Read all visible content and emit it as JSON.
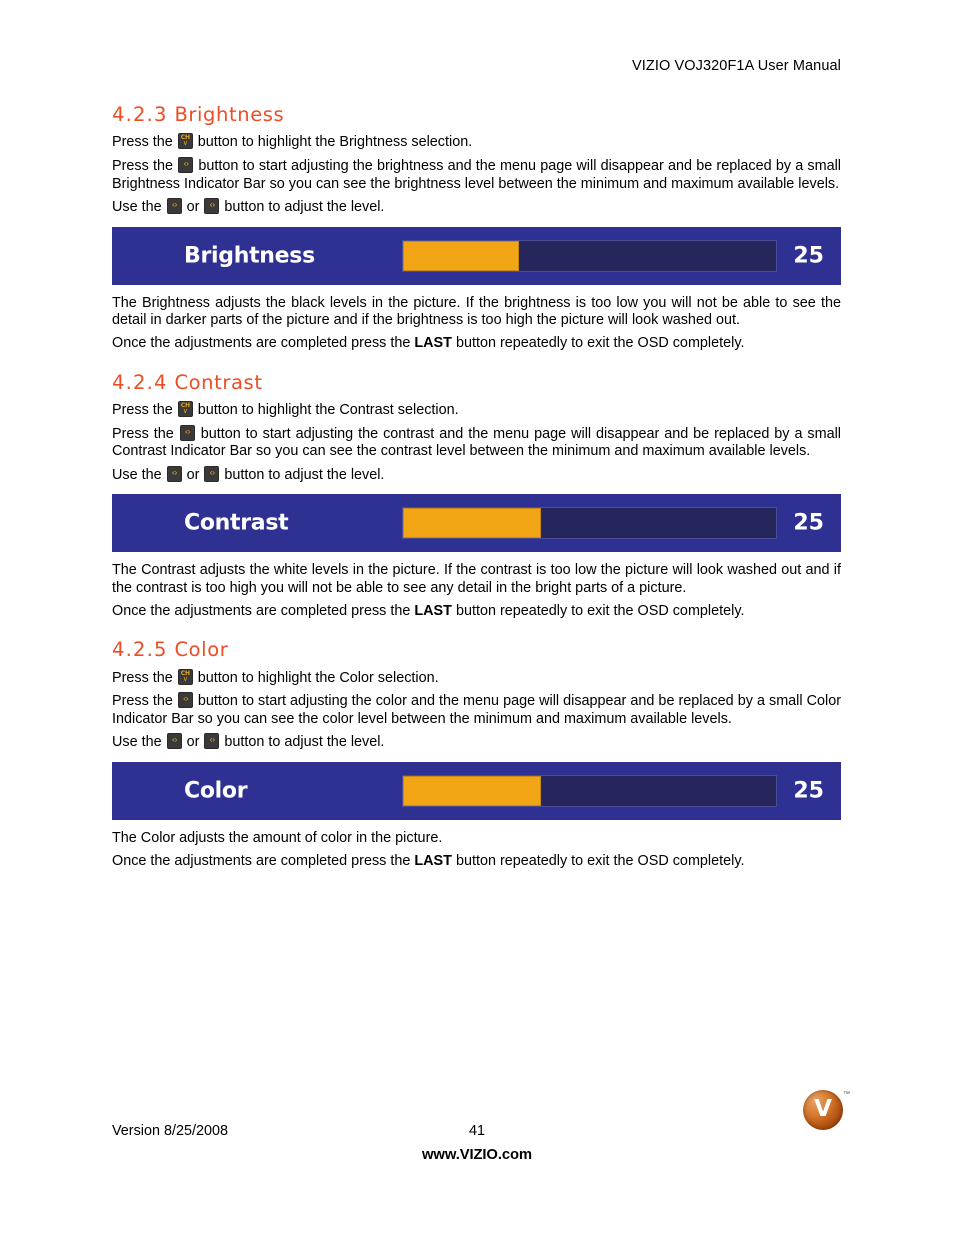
{
  "document": {
    "header_title": "VIZIO VOJ320F1A User Manual"
  },
  "icons": {
    "ch_down": {
      "name": "ch-down-button-icon",
      "top_label": "CH",
      "bottom_glyph": "∨"
    },
    "arrow_right": {
      "name": "right-arrow-button-icon",
      "glyph": "‹›"
    },
    "arrow_left": {
      "name": "left-arrow-button-icon",
      "glyph": "‹›"
    }
  },
  "sections": [
    {
      "id": "brightness",
      "number": "4.2.3",
      "title": "Brightness",
      "p1_before": "Press the",
      "p1_after": "button to highlight the Brightness selection.",
      "p2_before": "Press the",
      "p2_after": "button to start adjusting the brightness and the menu page will disappear and be replaced by a small Brightness Indicator Bar so you can see the brightness level between the minimum and maximum available levels.",
      "p3_before": "Use the",
      "p3_middle": "or",
      "p3_after": "button to adjust the level.",
      "osd": {
        "label": "Brightness",
        "value": "25",
        "fill_percent": 31
      },
      "desc": "The Brightness adjusts the black levels in the picture.  If the brightness is too low you will not be able to see the detail in darker parts of the picture and if the brightness is too high the picture will look washed out.",
      "exit_before": "Once the adjustments are completed press the",
      "exit_bold": "LAST",
      "exit_after": "button repeatedly to exit the OSD completely."
    },
    {
      "id": "contrast",
      "number": "4.2.4",
      "title": "Contrast",
      "p1_before": "Press the",
      "p1_after": "button to highlight the Contrast selection.",
      "p2_before": "Press the",
      "p2_after": "button to start adjusting the contrast and the menu page will disappear and be replaced by a small Contrast Indicator Bar so you can see the contrast level between the minimum and maximum available levels.",
      "p3_before": "Use the",
      "p3_middle": "or",
      "p3_after": "button to adjust the level.",
      "osd": {
        "label": "Contrast",
        "value": "25",
        "fill_percent": 37
      },
      "desc": "The Contrast adjusts the white levels in the picture.  If the contrast is too low the picture will look washed out and if the contrast is too high you will not be able to see any detail in the bright parts of a picture.",
      "exit_before": "Once the adjustments are completed press the",
      "exit_bold": "LAST",
      "exit_after": "button repeatedly to exit the OSD completely."
    },
    {
      "id": "color",
      "number": "4.2.5",
      "title": "Color",
      "p1_before": "Press the",
      "p1_after": "button to highlight the Color selection.",
      "p2_before": "Press the",
      "p2_after": "button to start adjusting the color and the menu page will disappear and be replaced by a small Color Indicator Bar so you can see the color level between the minimum and maximum available levels.",
      "p3_before": "Use the",
      "p3_middle": "or",
      "p3_after": "button to adjust the level.",
      "osd": {
        "label": "Color",
        "value": "25",
        "fill_percent": 37
      },
      "desc": "The Color adjusts the amount of color in the picture.",
      "exit_before": "Once the adjustments are completed press the",
      "exit_bold": "LAST",
      "exit_after": "button repeatedly to exit the OSD completely."
    }
  ],
  "footer": {
    "version": "Version 8/25/2008",
    "page_number": "41",
    "url": "www.VIZIO.com",
    "logo_letter": "V",
    "logo_tm": "™"
  },
  "colors": {
    "heading_orange": "#EE4C23",
    "osd_panel_blue": "#2E3191",
    "osd_track_navy": "#25265C",
    "osd_fill_orange": "#F2A515",
    "logo_bronze": "#C26A20"
  }
}
